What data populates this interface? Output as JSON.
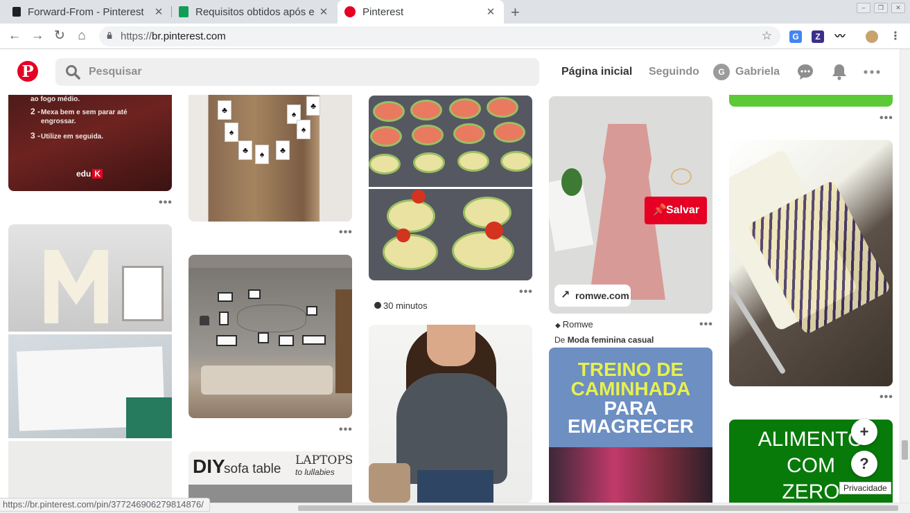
{
  "browser": {
    "tabs": [
      {
        "title": "Forward-From - Pinterest",
        "favicon": "doc-icon",
        "active": false
      },
      {
        "title": "Requisitos obtidos após e",
        "favicon": "sheets-icon",
        "active": false
      },
      {
        "title": "Pinterest",
        "favicon": "pinterest-icon",
        "active": true
      }
    ],
    "new_tab": "+",
    "url_prefix": "https://",
    "url_host": "br.pinterest.com",
    "status_url": "https://br.pinterest.com/pin/377246906279814876/"
  },
  "header": {
    "logo": "P",
    "search_placeholder": "Pesquisar",
    "nav_home": "Página inicial",
    "nav_following": "Seguindo",
    "avatar_initial": "G",
    "user_name": "Gabriela"
  },
  "colors": {
    "brand": "#e60023",
    "search_bg": "#efefef",
    "chrome_bg": "#dee1e6"
  },
  "pins": {
    "recipe": {
      "line1": "ao fogo médio.",
      "step2_num": "2 -",
      "step2": "Mexa bem e sem parar até engrossar.",
      "step3_num": "3 -",
      "step3": "Utilize em seguida.",
      "brand": "edu",
      "brand_k": "K"
    },
    "diy": {
      "title": "DIY",
      "subtitle": "sofa table",
      "right1": "LAPTOPS",
      "right2": "to lullabies"
    },
    "food": {
      "duration": "30 minutos"
    },
    "dress": {
      "save": "Salvar",
      "domain": "romwe.com",
      "board_name": "Romwe",
      "from_prefix": "De",
      "from_board": "Moda feminina casual"
    },
    "walk": {
      "line1": "TREINO DE",
      "line2": "CAMINHADA",
      "line3": "PARA",
      "line4": "EMAGRECER"
    },
    "alimento": {
      "line1": "ALIMENTO",
      "line2": "COM",
      "line3": "ZERO CALORIAS"
    }
  },
  "more_label": "•••",
  "fab_add": "+",
  "fab_help": "?",
  "privacy": "Privacidade"
}
